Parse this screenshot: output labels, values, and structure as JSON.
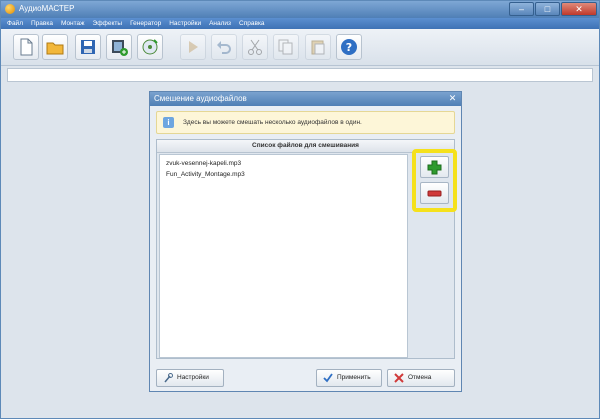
{
  "app": {
    "title": "АудиоМАСТЕР"
  },
  "menu": [
    "Файл",
    "Правка",
    "Монтаж",
    "Эффекты",
    "Генератор",
    "Настройки",
    "Анализ",
    "Справка"
  ],
  "toolbar": {
    "buttons": [
      {
        "name": "new-file",
        "enabled": true
      },
      {
        "name": "open-folder",
        "enabled": true
      },
      {
        "name": "save",
        "enabled": true
      },
      {
        "name": "video-add",
        "enabled": true
      },
      {
        "name": "record",
        "enabled": true
      },
      {
        "name": "play-marker",
        "enabled": false
      },
      {
        "name": "undo",
        "enabled": false
      },
      {
        "name": "cut",
        "enabled": false
      },
      {
        "name": "copy",
        "enabled": false
      },
      {
        "name": "paste",
        "enabled": false
      },
      {
        "name": "help",
        "enabled": true
      }
    ]
  },
  "dialog": {
    "title": "Смешение аудиофайлов",
    "hint": "Здесь вы можете смешать несколько аудиофайлов в один.",
    "list_header": "Список файлов для смешивания",
    "files": [
      "zvuk-vesennej-kapeli.mp3",
      "Fun_Activity_Montage.mp3"
    ],
    "settings_label": "Настройки",
    "apply_label": "Применить",
    "cancel_label": "Отмена"
  },
  "colors": {
    "highlight": "#f5e11c",
    "add": "#2e9b2e",
    "remove": "#d03a3a",
    "titlebar": "#4f7fb6"
  }
}
